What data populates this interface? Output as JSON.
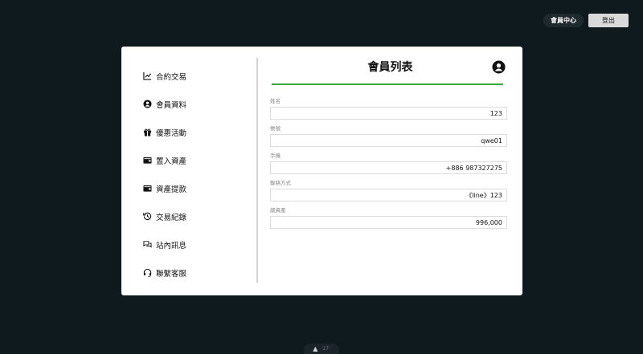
{
  "header": {
    "member_center_label": "會員中心",
    "logout_label": "登出"
  },
  "sidebar": {
    "items": [
      {
        "label": "合約交易",
        "icon": "chart-line-icon"
      },
      {
        "label": "會員資料",
        "icon": "user-circle-icon"
      },
      {
        "label": "優惠活動",
        "icon": "gift-icon"
      },
      {
        "label": "置入資產",
        "icon": "wallet-icon"
      },
      {
        "label": "資產提款",
        "icon": "wallet-icon"
      },
      {
        "label": "交易紀錄",
        "icon": "history-icon"
      },
      {
        "label": "站內訊息",
        "icon": "chat-bubbles-icon"
      },
      {
        "label": "聯繫客服",
        "icon": "headset-icon"
      }
    ]
  },
  "main": {
    "title": "會員列表",
    "accent_color": "#3aa83a",
    "fields": [
      {
        "label": "姓名",
        "value": "123"
      },
      {
        "label": "帳號",
        "value": "qwe01"
      },
      {
        "label": "手機",
        "value": "+886 987327275"
      },
      {
        "label": "聯絡方式",
        "value": "《line》123"
      },
      {
        "label": "總資產",
        "value": "996,000"
      }
    ]
  },
  "footer": {
    "badge_text": "·17·"
  }
}
